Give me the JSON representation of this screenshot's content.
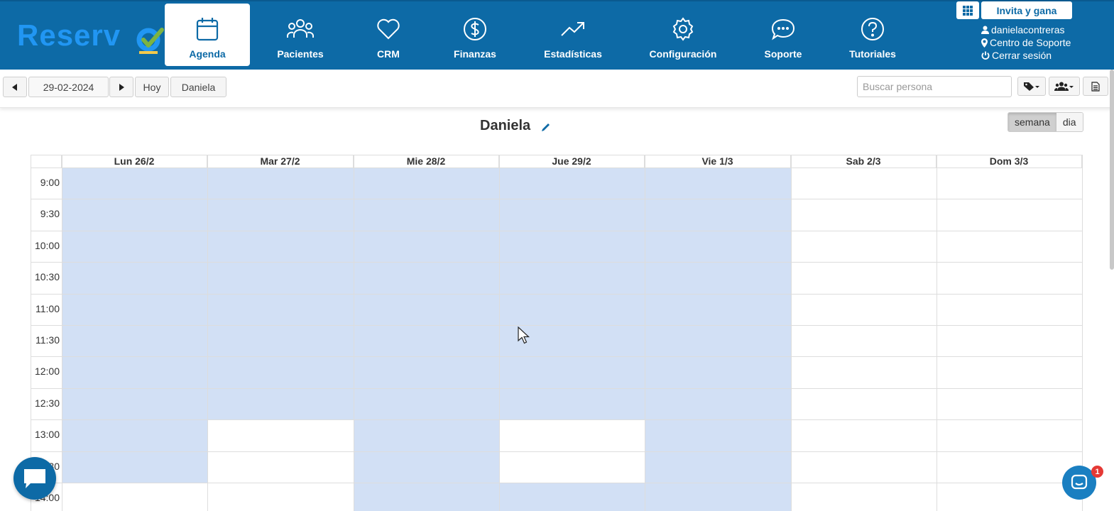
{
  "brand": {
    "logo_text": "Reserv",
    "logo_color": "#2196f3",
    "check_color": "#7cb342"
  },
  "nav": {
    "items": [
      {
        "label": "Agenda",
        "icon": "calendar-icon",
        "active": true
      },
      {
        "label": "Pacientes",
        "icon": "users-icon",
        "active": false
      },
      {
        "label": "CRM",
        "icon": "heart-icon",
        "active": false
      },
      {
        "label": "Finanzas",
        "icon": "dollar-circle-icon",
        "active": false
      },
      {
        "label": "Estadísticas",
        "icon": "trending-up-icon",
        "active": false
      },
      {
        "label": "Configuración",
        "icon": "gear-icon",
        "active": false
      },
      {
        "label": "Soporte",
        "icon": "chat-bubble-icon",
        "active": false
      },
      {
        "label": "Tutoriales",
        "icon": "help-circle-icon",
        "active": false
      }
    ],
    "bar_color": "#0d6aa6"
  },
  "account": {
    "apps_icon": "grid-icon",
    "invite_label": "Invita y gana",
    "username": "danielacontreras",
    "support_center": "Centro de Soporte",
    "logout": "Cerrar sesión"
  },
  "toolbar": {
    "prev_icon": "triangle-left-icon",
    "date_value": "29-02-2024",
    "next_icon": "triangle-right-icon",
    "today_label": "Hoy",
    "professional_label": "Daniela",
    "search_placeholder": "Buscar persona",
    "tag_icon": "tag-dropdown-icon",
    "group_icon": "group-dropdown-icon",
    "doc_icon": "document-icon"
  },
  "calendar": {
    "title": "Daniela",
    "view_week": "semana",
    "view_day": "dia",
    "selected_view": "semana",
    "days": [
      "Lun 26/2",
      "Mar 27/2",
      "Mie 28/2",
      "Jue 29/2",
      "Vie 1/3",
      "Sab 2/3",
      "Dom 3/3"
    ],
    "times": [
      "9:00",
      "9:30",
      "10:00",
      "10:30",
      "11:00",
      "11:30",
      "12:00",
      "12:30",
      "13:00",
      "13:30",
      "14:00"
    ],
    "availability_color": "#d2e0f5",
    "availability": [
      {
        "day": 0,
        "from": 0,
        "to": 10
      },
      {
        "day": 1,
        "from": 0,
        "to": 8
      },
      {
        "day": 2,
        "from": 0,
        "to": 11
      },
      {
        "day": 3,
        "from": 0,
        "to": 8
      },
      {
        "day": 3,
        "from": 10,
        "to": 11
      },
      {
        "day": 4,
        "from": 0,
        "to": 11
      }
    ]
  },
  "widgets": {
    "chat_left_icon": "chat-icon",
    "chat_right_icon": "messenger-icon",
    "notification_count": "1"
  }
}
